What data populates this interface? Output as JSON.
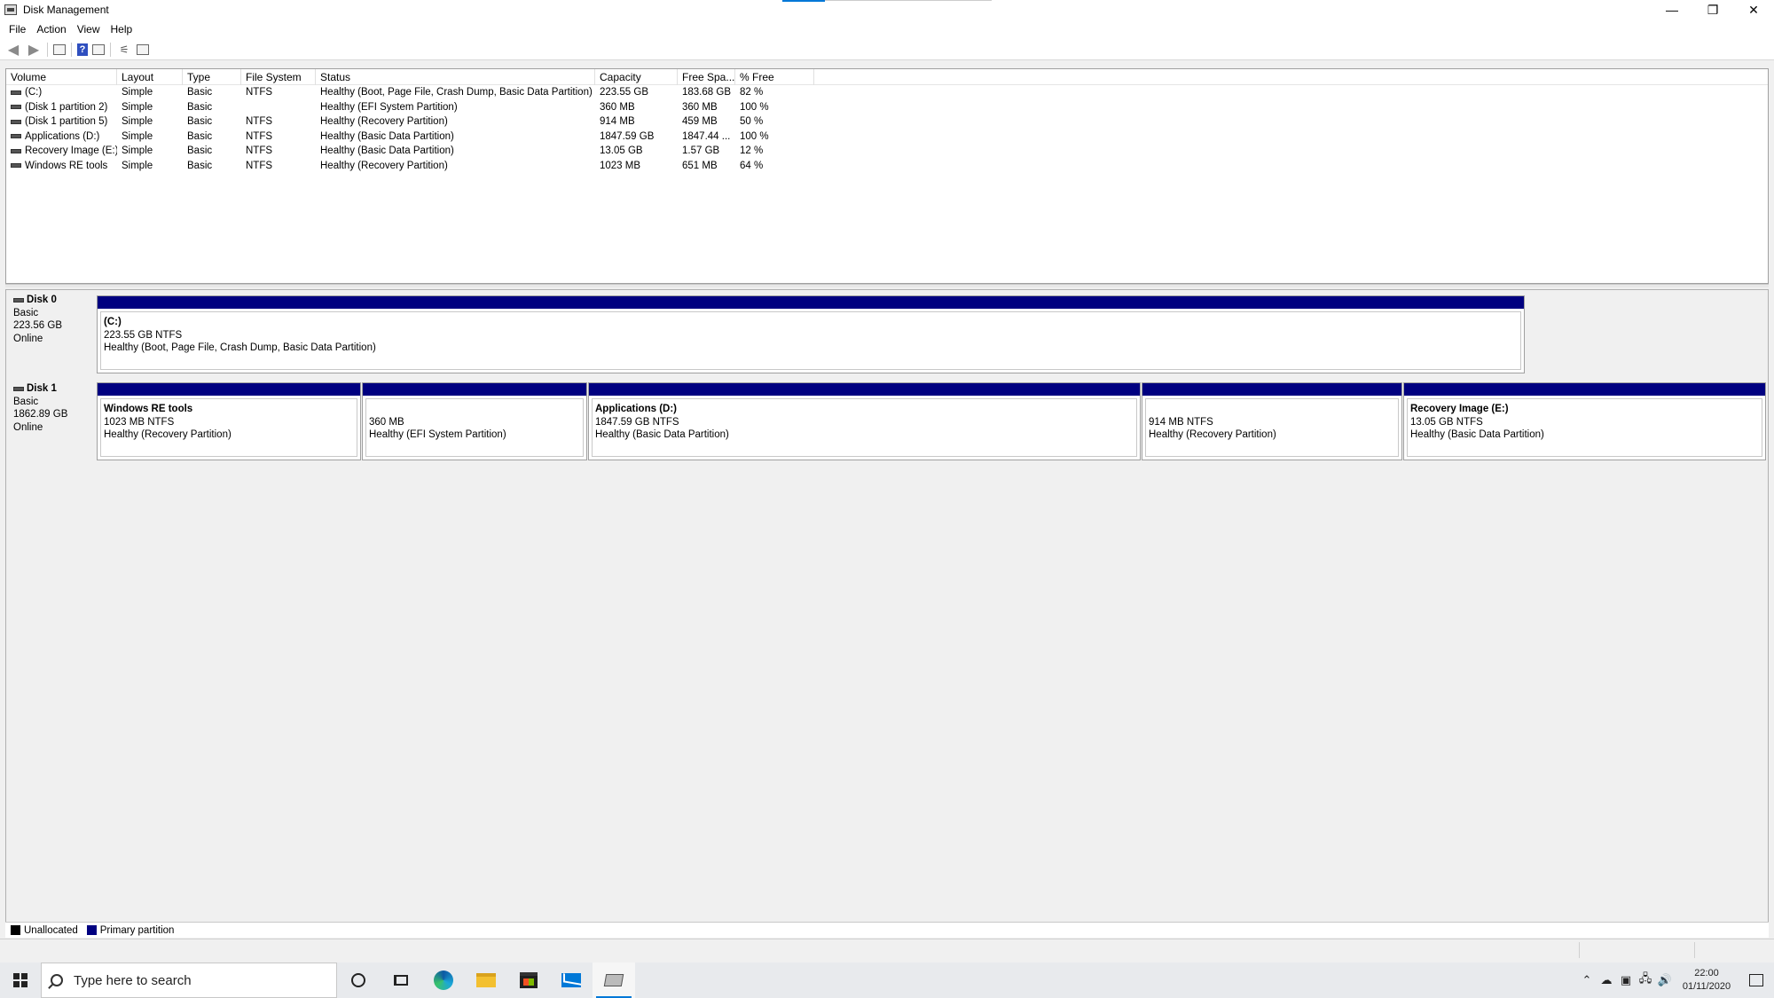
{
  "window": {
    "title": "Disk Management",
    "controls": {
      "minimize": "—",
      "restore": "❐",
      "close": "✕"
    }
  },
  "menu": [
    "File",
    "Action",
    "View",
    "Help"
  ],
  "toolbar_icons": [
    "back-arrow-icon",
    "forward-arrow-icon",
    "show-hide-console-tree-icon",
    "help-icon",
    "properties-icon",
    "refresh-icon",
    "settings-icon"
  ],
  "volume_list": {
    "columns": [
      "Volume",
      "Layout",
      "Type",
      "File System",
      "Status",
      "Capacity",
      "Free Spa...",
      "% Free"
    ],
    "rows": [
      [
        "(C:)",
        "Simple",
        "Basic",
        "NTFS",
        "Healthy (Boot, Page File, Crash Dump, Basic Data Partition)",
        "223.55 GB",
        "183.68 GB",
        "82 %"
      ],
      [
        "(Disk 1 partition 2)",
        "Simple",
        "Basic",
        "",
        "Healthy (EFI System Partition)",
        "360 MB",
        "360 MB",
        "100 %"
      ],
      [
        "(Disk 1 partition 5)",
        "Simple",
        "Basic",
        "NTFS",
        "Healthy (Recovery Partition)",
        "914 MB",
        "459 MB",
        "50 %"
      ],
      [
        "Applications (D:)",
        "Simple",
        "Basic",
        "NTFS",
        "Healthy (Basic Data Partition)",
        "1847.59 GB",
        "1847.44 ...",
        "100 %"
      ],
      [
        "Recovery Image (E:)",
        "Simple",
        "Basic",
        "NTFS",
        "Healthy (Basic Data Partition)",
        "13.05 GB",
        "1.57 GB",
        "12 %"
      ],
      [
        "Windows RE tools",
        "Simple",
        "Basic",
        "NTFS",
        "Healthy (Recovery Partition)",
        "1023 MB",
        "651 MB",
        "64 %"
      ]
    ]
  },
  "disks": [
    {
      "name": "Disk 0",
      "type": "Basic",
      "size": "223.56 GB",
      "state": "Online",
      "partitions": [
        {
          "name": "(C:)",
          "size": "223.55 GB NTFS",
          "status": "Healthy (Boot, Page File, Crash Dump, Basic Data Partition)"
        }
      ]
    },
    {
      "name": "Disk 1",
      "type": "Basic",
      "size": "1862.89 GB",
      "state": "Online",
      "partitions": [
        {
          "name": "Windows RE tools",
          "size": "1023 MB NTFS",
          "status": "Healthy (Recovery Partition)"
        },
        {
          "name": "",
          "size": "360 MB",
          "status": "Healthy (EFI System Partition)"
        },
        {
          "name": "Applications  (D:)",
          "size": "1847.59 GB NTFS",
          "status": "Healthy (Basic Data Partition)"
        },
        {
          "name": "",
          "size": "914 MB NTFS",
          "status": "Healthy (Recovery Partition)"
        },
        {
          "name": "Recovery Image  (E:)",
          "size": "13.05 GB NTFS",
          "status": "Healthy (Basic Data Partition)"
        }
      ]
    }
  ],
  "legend": [
    {
      "label": "Unallocated",
      "color": "#000000"
    },
    {
      "label": "Primary partition",
      "color": "#000080"
    }
  ],
  "taskbar": {
    "search_placeholder": "Type here to search",
    "apps": [
      "cortana-icon",
      "task-view-icon",
      "edge-icon",
      "file-explorer-icon",
      "store-icon",
      "mail-icon",
      "disk-management-icon"
    ],
    "time": "22:00",
    "date": "01/11/2020"
  }
}
